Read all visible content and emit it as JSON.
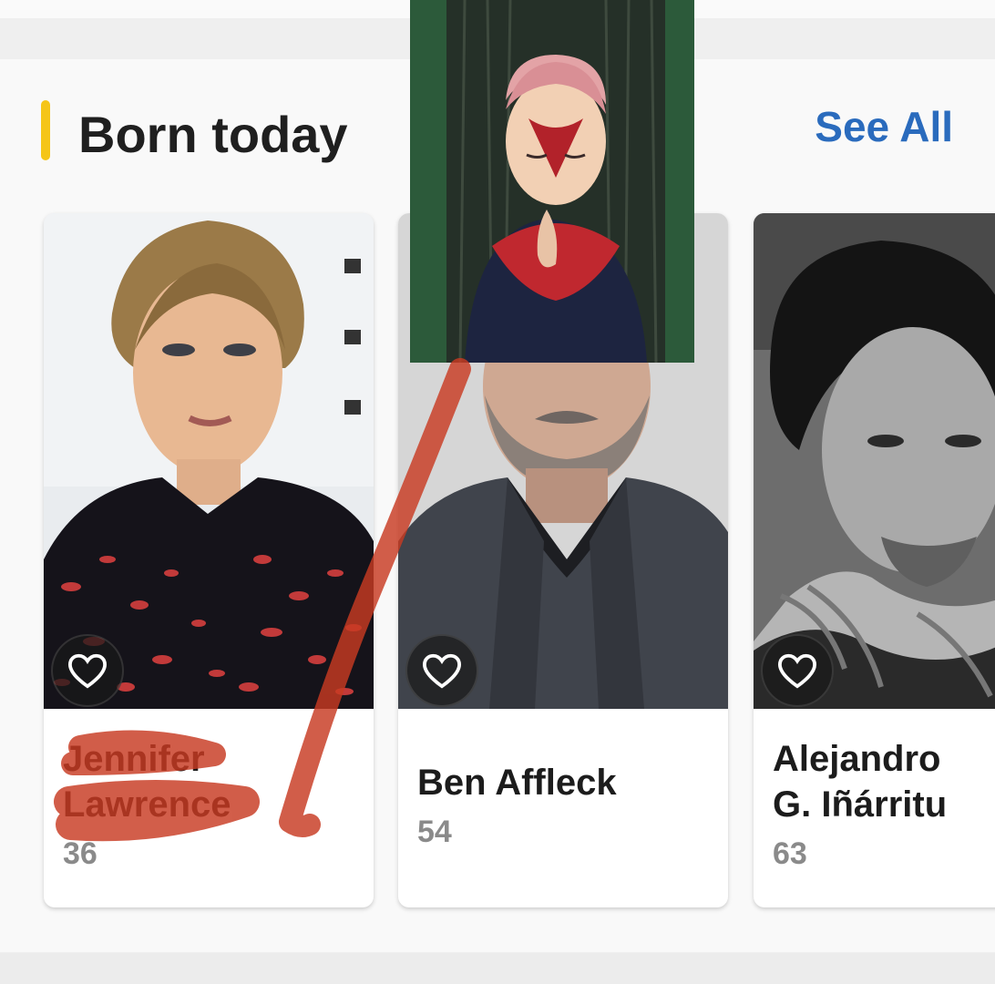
{
  "section": {
    "title": "Born today",
    "see_all_label": "See All",
    "accent_color": "#f5c518",
    "link_color": "#2a6bbd"
  },
  "people": [
    {
      "name_line1": "Jennifer",
      "name_line2": "Lawrence",
      "age": "36"
    },
    {
      "name": "Ben Affleck",
      "age": "54"
    },
    {
      "name_line1": "Alejandro",
      "name_line2": "G. Iñárritu",
      "age": "63"
    }
  ],
  "icons": {
    "favorite": "heart-outline-icon"
  },
  "annotations": {
    "scribble_color": "#c83a22"
  }
}
